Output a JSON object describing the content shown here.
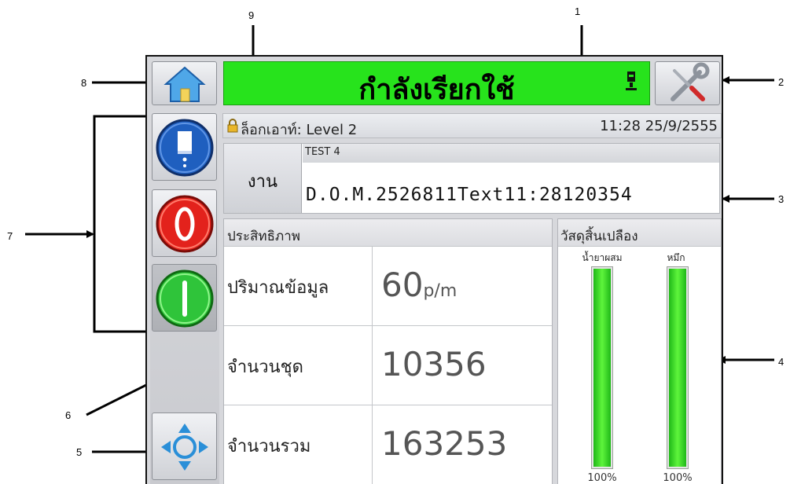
{
  "callouts": [
    "1",
    "2",
    "3",
    "4",
    "5",
    "6",
    "7",
    "8",
    "9"
  ],
  "status": {
    "text": "กำลังเรียกใช้"
  },
  "info_bar": {
    "user": "ล็อกเอาท์: Level 2",
    "datetime": "11:28 25/9/2555"
  },
  "job": {
    "button_label": "งาน",
    "name": "TEST 4",
    "message": "D.O.M.2526811Text11:28120354"
  },
  "performance": {
    "title": "ประสิทธิภาพ",
    "rows": [
      {
        "label": "ปริมาณข้อมูล",
        "value": "60",
        "unit": "p/m"
      },
      {
        "label": "จำนวนชุด",
        "value": "10356",
        "unit": ""
      },
      {
        "label": "จำนวนรวม",
        "value": "163253",
        "unit": ""
      }
    ]
  },
  "consumables": {
    "title": "วัสดุสิ้นเปลือง",
    "items": [
      {
        "label": "น้ำยาผสม",
        "percent_text": "100%",
        "level": 1.0
      },
      {
        "label": "หมึก",
        "percent_text": "100%",
        "level": 1.0
      }
    ]
  },
  "colors": {
    "status_green": "#27e31c",
    "gauge_green": "#3ee02a",
    "stop_red": "#e3221c",
    "start_green": "#2fc43a",
    "info_blue": "#1f5fbf"
  },
  "icons": {
    "home": "home-icon",
    "tools": "wrench-screwdriver-icon",
    "printhead": "printhead-icon",
    "lock": "lock-icon",
    "info": "info-book-icon",
    "stop": "stop-icon",
    "start": "start-icon",
    "navigation": "navigation-arrows-icon"
  }
}
